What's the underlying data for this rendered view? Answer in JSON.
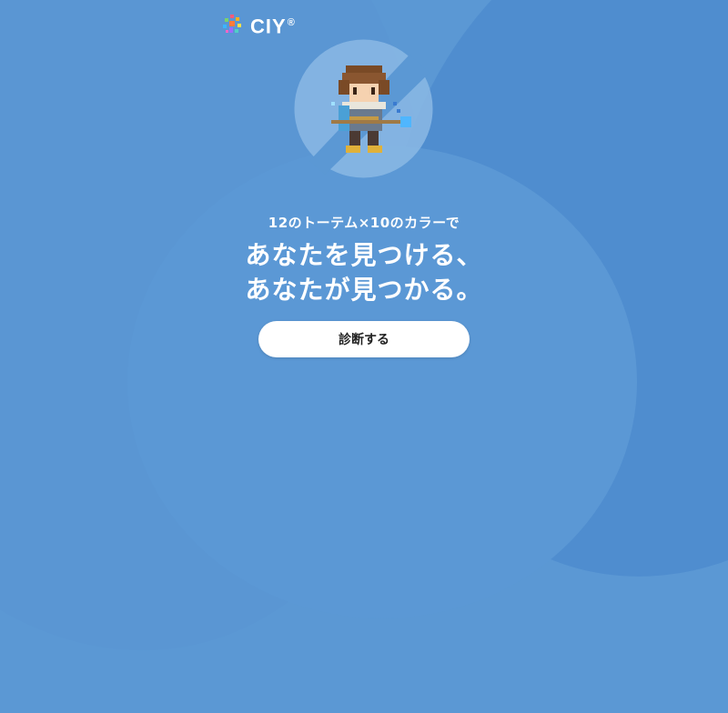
{
  "brand": {
    "name": "CIY",
    "reg_mark": "®"
  },
  "hero": {
    "subtitle": "12のトーテム×10のカラーで",
    "headline_line1": "あなたを見つける、",
    "headline_line2": "あなたが見つかる。"
  },
  "cta": {
    "label": "診断する"
  },
  "colors": {
    "background": "#5b98d4",
    "emblem": "#8bb8e4",
    "text": "#ffffff",
    "button": "#ffffff",
    "button_text": "#222222"
  }
}
